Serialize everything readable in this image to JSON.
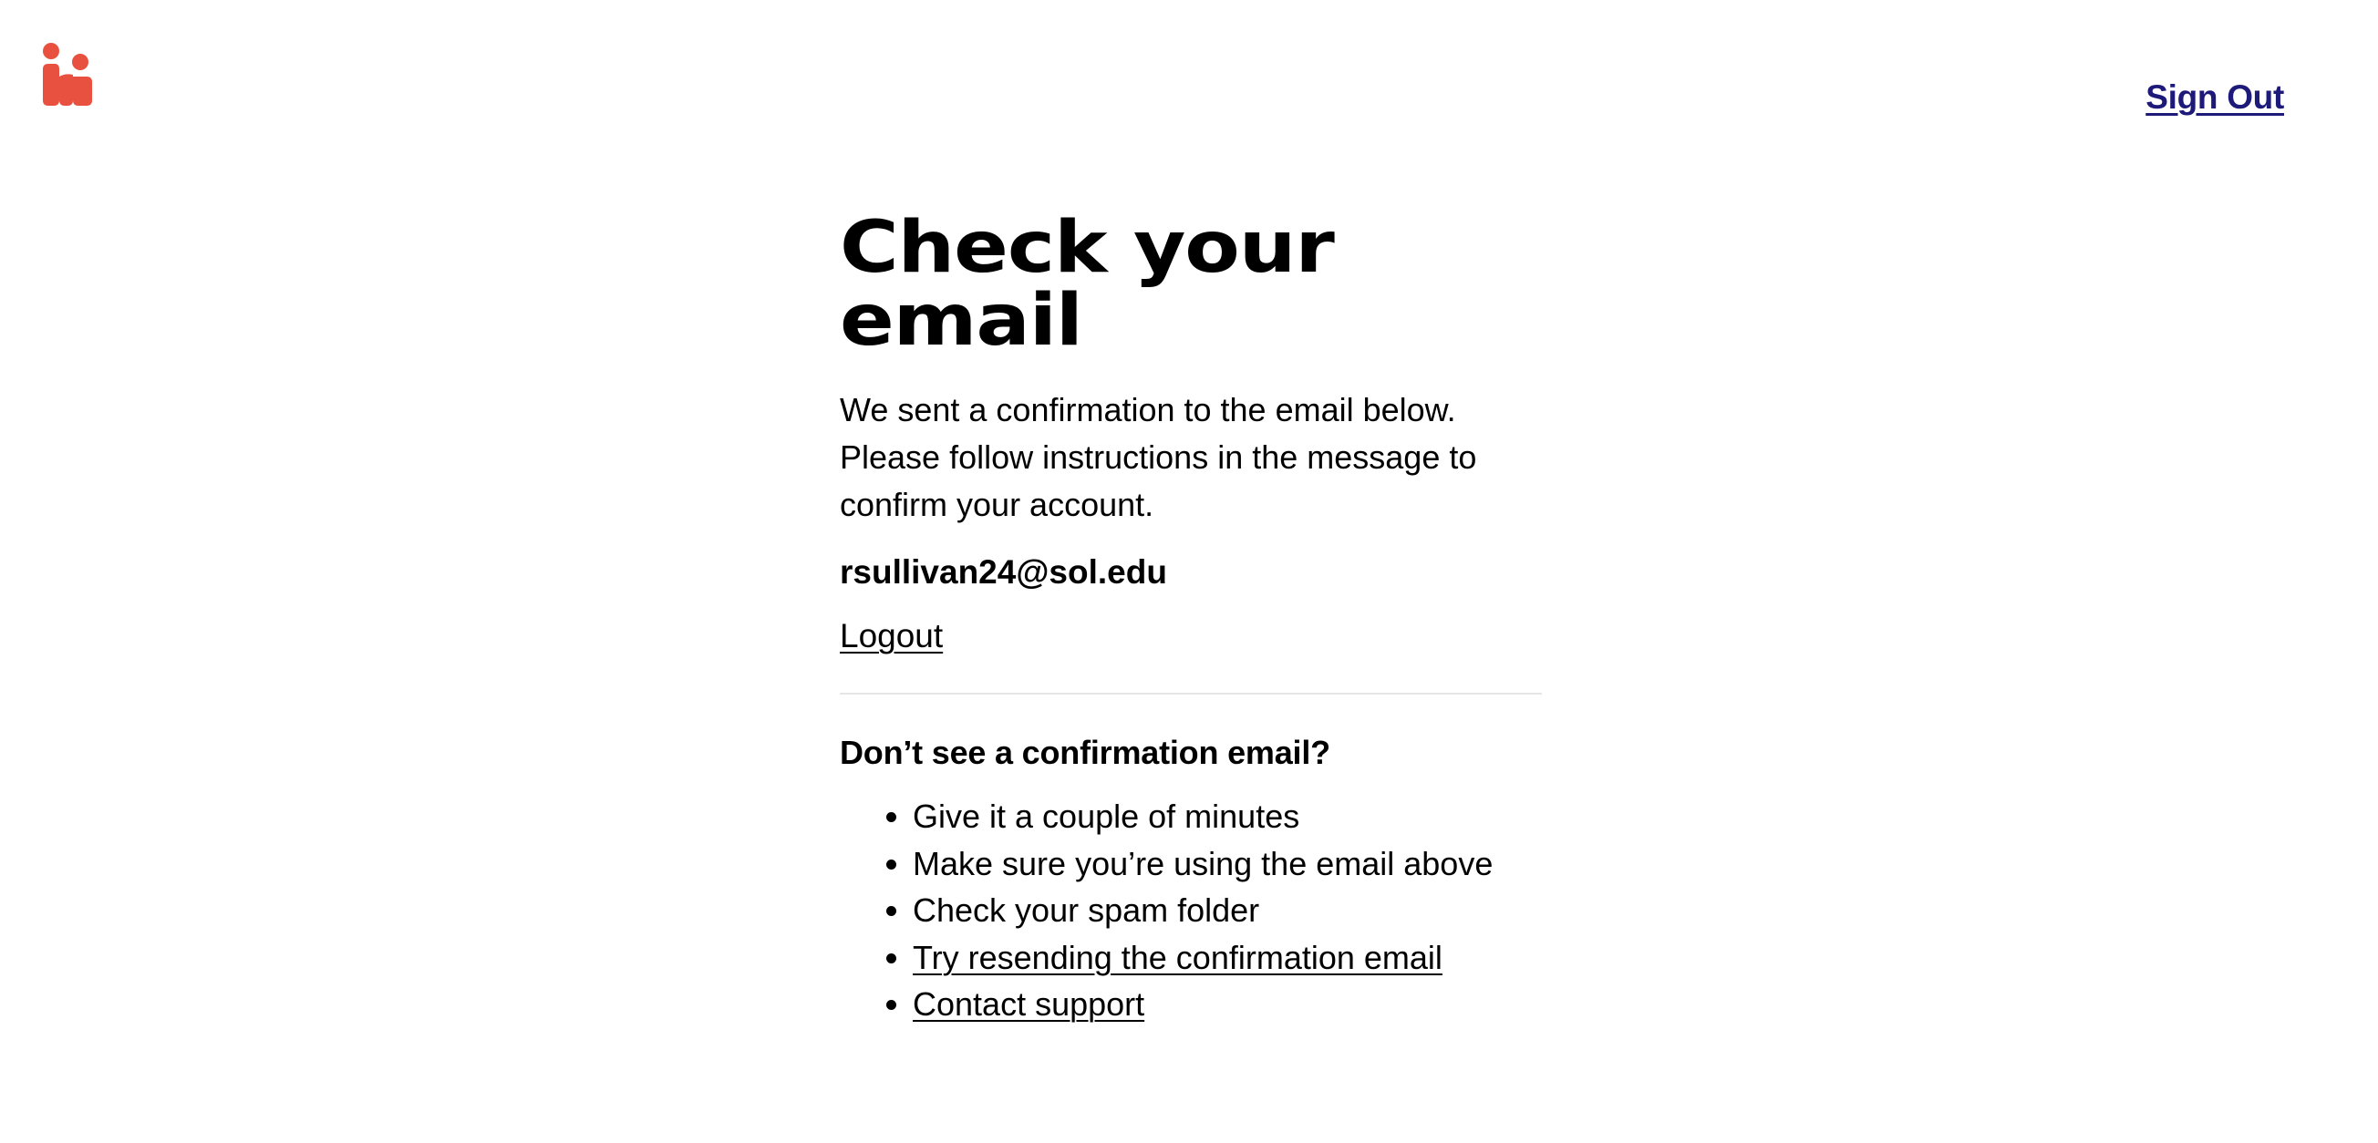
{
  "header": {
    "logo_icon": "handshake-logo-icon",
    "logo_color": "#e8513f",
    "sign_out_label": "Sign Out",
    "sign_out_color": "#1d1a7a"
  },
  "main": {
    "title": "Check your email",
    "intro": "We sent a confirmation to the email below. Please follow instructions in the message to confirm your account.",
    "email": "rsullivan24@sol.edu",
    "logout_label": "Logout"
  },
  "help": {
    "heading": "Don’t see a confirmation email?",
    "tips": [
      "Give it a couple of minutes",
      "Make sure you’re using the email above",
      "Check your spam folder",
      "Try resending the confirmation email",
      "Contact support"
    ]
  }
}
